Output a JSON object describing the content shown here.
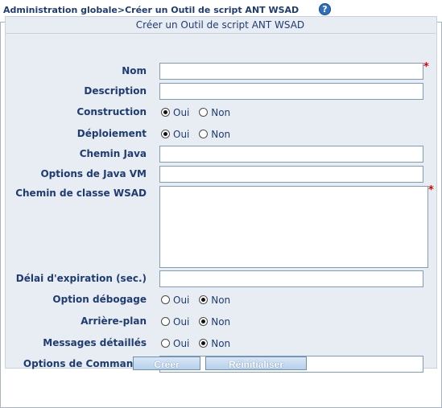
{
  "header": {
    "breadcrumb": "Administration globale>Créer un Outil de script ANT WSAD",
    "help": "?"
  },
  "panel": {
    "title": "Créer un Outil de script ANT WSAD"
  },
  "fields": {
    "nom": "Nom",
    "description": "Description",
    "construction": "Construction",
    "deploiement": "Déploiement",
    "chemin_java": "Chemin Java",
    "options_java_vm": "Options de Java VM",
    "chemin_classe_wsad": "Chemin de classe WSAD",
    "delai_expiration": "Délai d'expiration (sec.)",
    "option_debogage": "Option débogage",
    "arriere_plan": "Arrière-plan",
    "messages_detailles": "Messages détaillés",
    "options_commande": "Options de Commande"
  },
  "radio": {
    "oui": "Oui",
    "non": "Non"
  },
  "required_mark": "*",
  "buttons": {
    "creer": "Créer",
    "reinitialiser": "Réinitialiser"
  }
}
